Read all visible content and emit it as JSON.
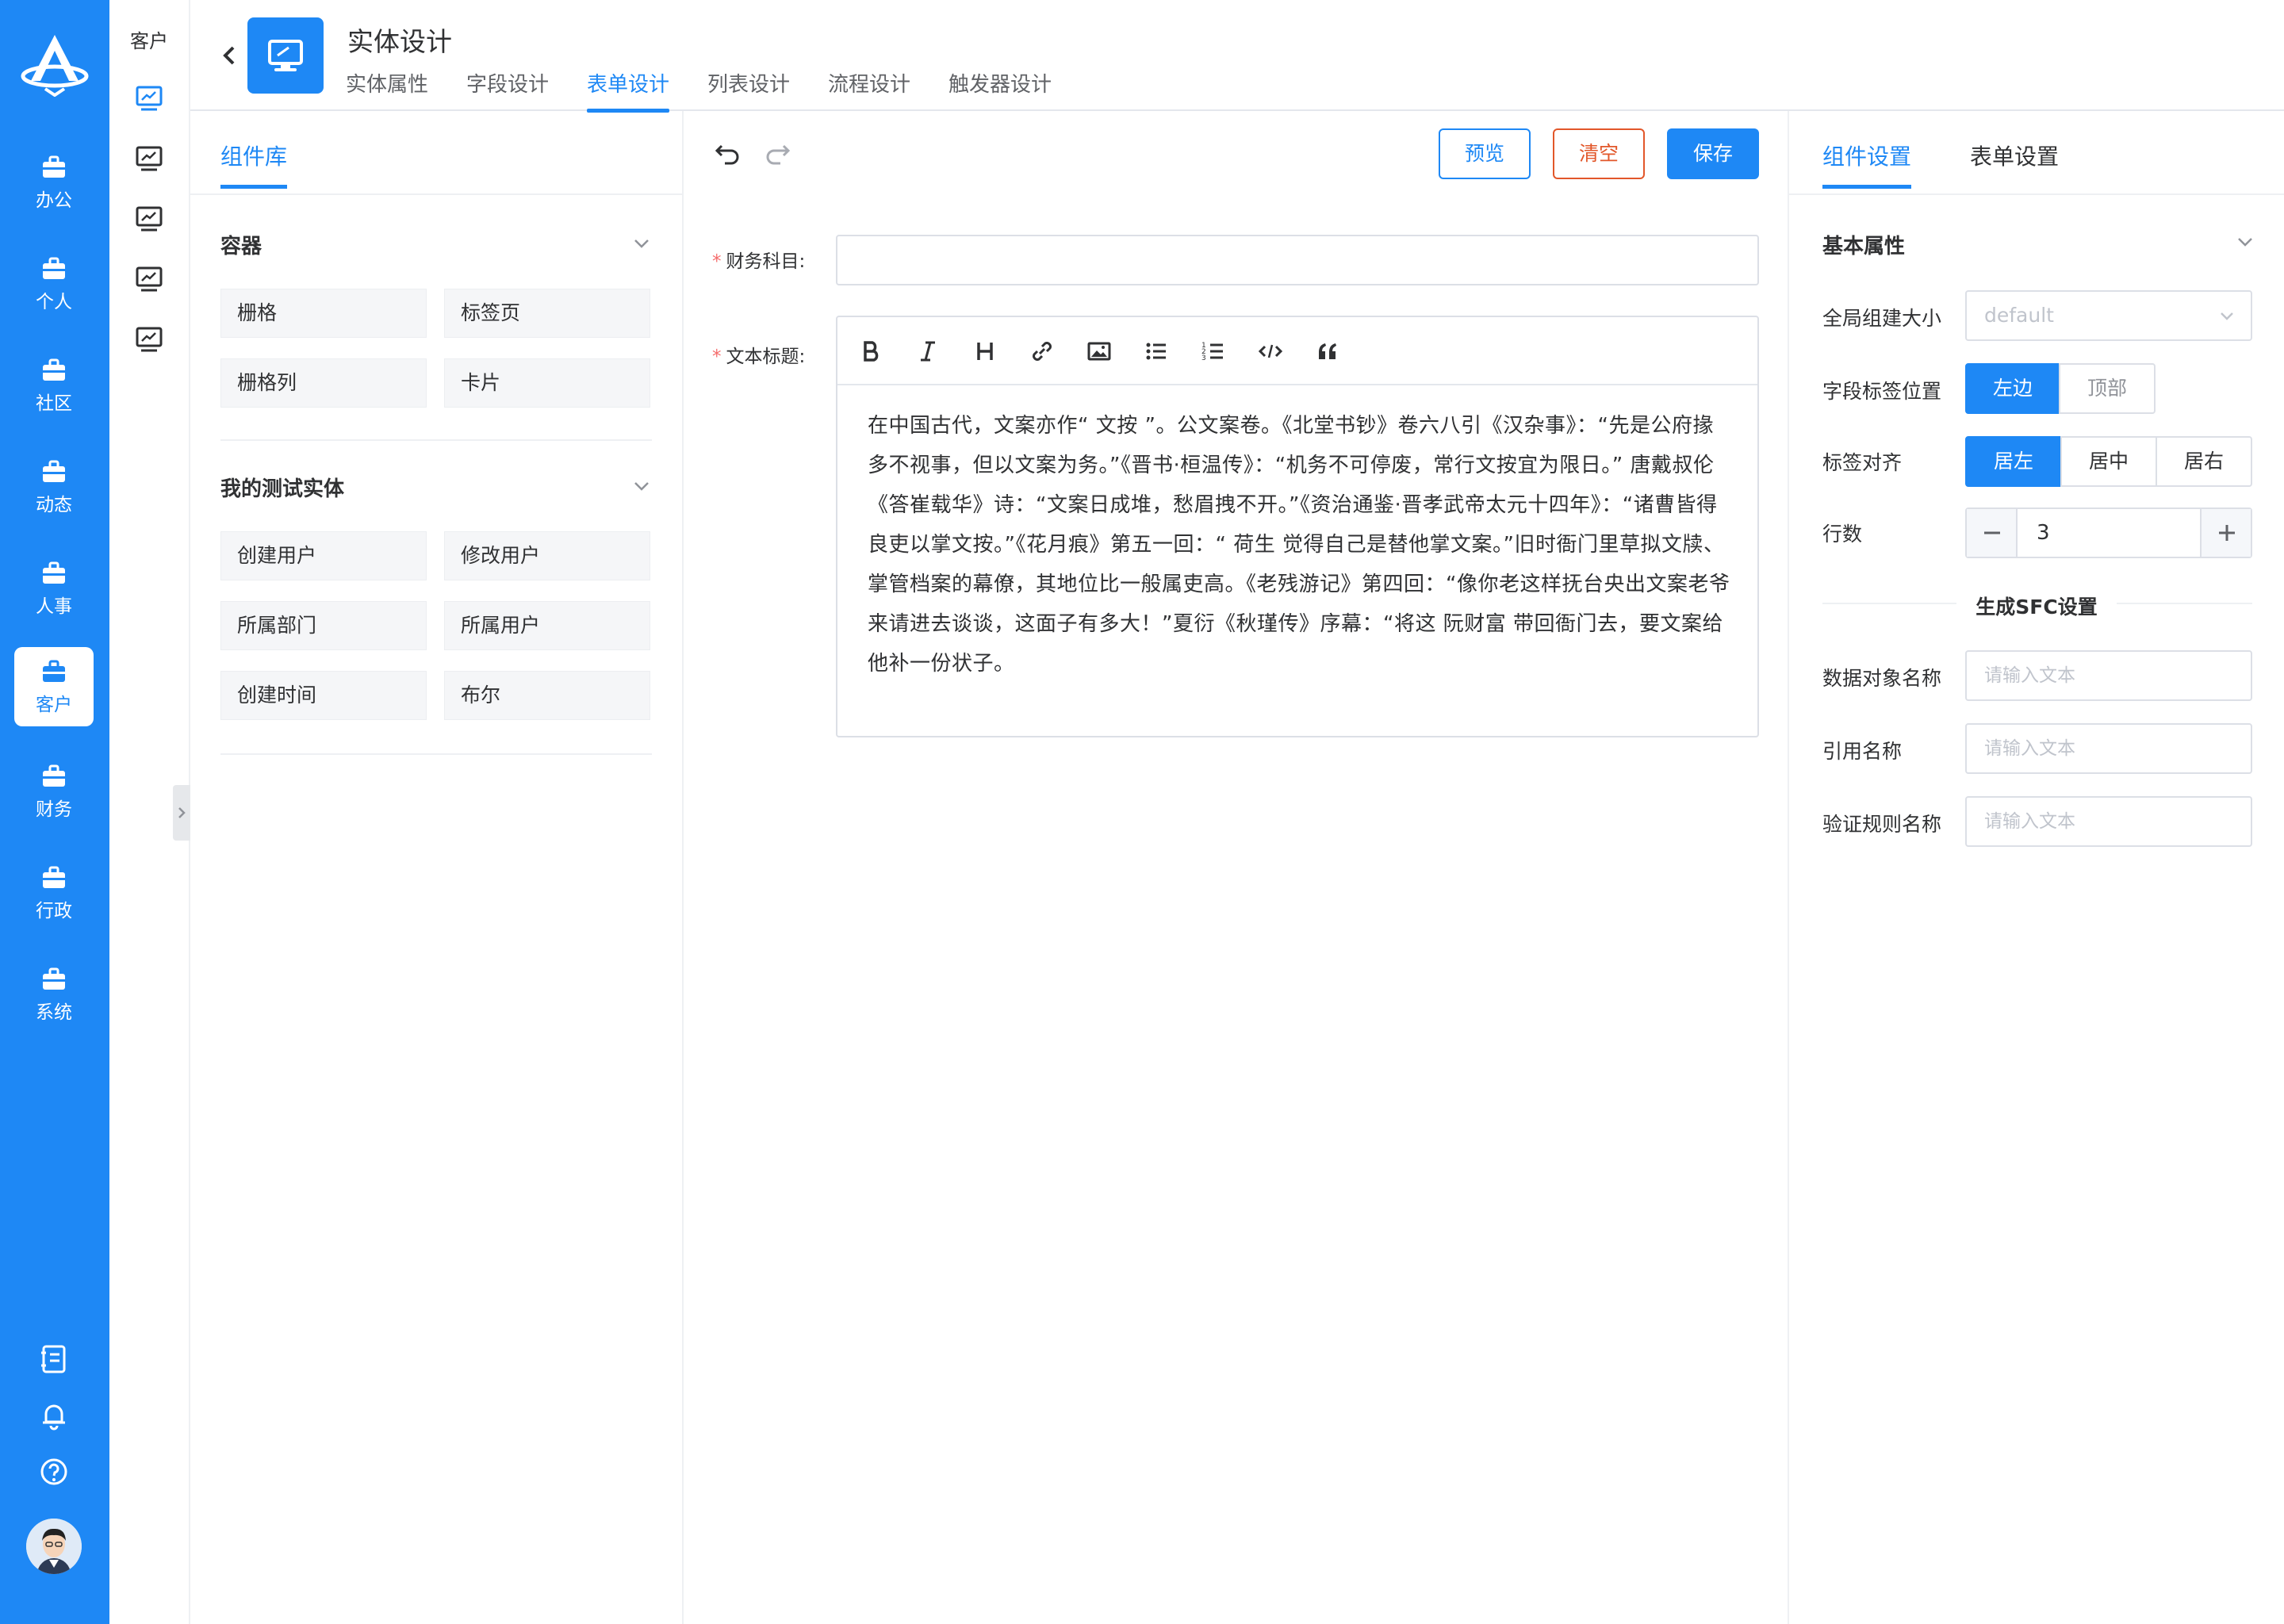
{
  "nav": {
    "items": [
      {
        "label": "办公",
        "icon": "briefcase-icon"
      },
      {
        "label": "个人",
        "icon": "briefcase-icon"
      },
      {
        "label": "社区",
        "icon": "briefcase-icon"
      },
      {
        "label": "动态",
        "icon": "briefcase-icon"
      },
      {
        "label": "人事",
        "icon": "briefcase-icon"
      },
      {
        "label": "客户",
        "icon": "briefcase-icon",
        "active": true
      },
      {
        "label": "财务",
        "icon": "briefcase-icon"
      },
      {
        "label": "行政",
        "icon": "briefcase-icon"
      },
      {
        "label": "系统",
        "icon": "briefcase-icon"
      }
    ],
    "bottom_icons": [
      "notebook-icon",
      "bell-icon",
      "help-icon"
    ]
  },
  "sub_sidebar": {
    "title": "客户",
    "items": [
      "monitor-icon",
      "monitor-icon",
      "monitor-icon",
      "monitor-icon",
      "monitor-icon"
    ]
  },
  "header": {
    "title": "实体设计",
    "tabs": [
      {
        "label": "实体属性"
      },
      {
        "label": "字段设计"
      },
      {
        "label": "表单设计",
        "active": true
      },
      {
        "label": "列表设计"
      },
      {
        "label": "流程设计"
      },
      {
        "label": "触发器设计"
      }
    ]
  },
  "library": {
    "tab": "组件库",
    "groups": [
      {
        "title": "容器",
        "items": [
          "栅格",
          "标签页",
          "栅格列",
          "卡片"
        ]
      },
      {
        "title": "我的测试实体",
        "items": [
          "创建用户",
          "修改用户",
          "所属部门",
          "所属用户",
          "创建时间",
          "布尔"
        ]
      }
    ]
  },
  "toolbar": {
    "preview": "预览",
    "clear": "清空",
    "save": "保存"
  },
  "form": {
    "required_mark": "*",
    "finance_label": "财务科目:",
    "finance_value": "",
    "title_label": "文本标题:",
    "editor_tools": [
      "bold-icon",
      "italic-icon",
      "heading-icon",
      "link-icon",
      "image-icon",
      "bullet-list-icon",
      "ordered-list-icon",
      "code-icon",
      "quote-icon"
    ],
    "editor_text": "在中国古代，文案亦作“ 文按 ”。公文案卷。《北堂书钞》卷六八引《汉杂事》：“先是公府掾多不视事，但以文案为务。”《晋书·桓温传》：“机务不可停废，常行文按宜为限日。” 唐戴叔伦《答崔载华》诗：“文案日成堆，愁眉拽不开。”《资治通鉴·晋孝武帝太元十四年》：“诸曹皆得良吏以掌文按。”《花月痕》第五一回：“ 荷生 觉得自己是替他掌文案。”旧时衙门里草拟文牍、掌管档案的幕僚，其地位比一般属吏高。《老残游记》第四回：“像你老这样抚台央出文案老爷来请进去谈谈，这面子有多大！”夏衍《秋瑾传》序幕：“将这 阮财富 带回衙门去，要文案给他补一份状子。"
  },
  "settings": {
    "tabs": [
      "组件设置",
      "表单设置"
    ],
    "basic_props_title": "基本属性",
    "size_label": "全局组建大小",
    "size_value": "default",
    "label_position_label": "字段标签位置",
    "label_position_options": [
      "左边",
      "顶部"
    ],
    "label_position_selected": 0,
    "label_align_label": "标签对齐",
    "label_align_options": [
      "居左",
      "居中",
      "居右"
    ],
    "label_align_selected": 0,
    "rows_label": "行数",
    "rows_value": "3",
    "sfc_title": "生成SFC设置",
    "data_object_label": "数据对象名称",
    "ref_name_label": "引用名称",
    "validation_label": "验证规则名称",
    "input_placeholder": "请输入文本"
  },
  "colors": {
    "primary": "#1e88f5",
    "danger": "#e2572a",
    "required": "#f56c6c"
  }
}
